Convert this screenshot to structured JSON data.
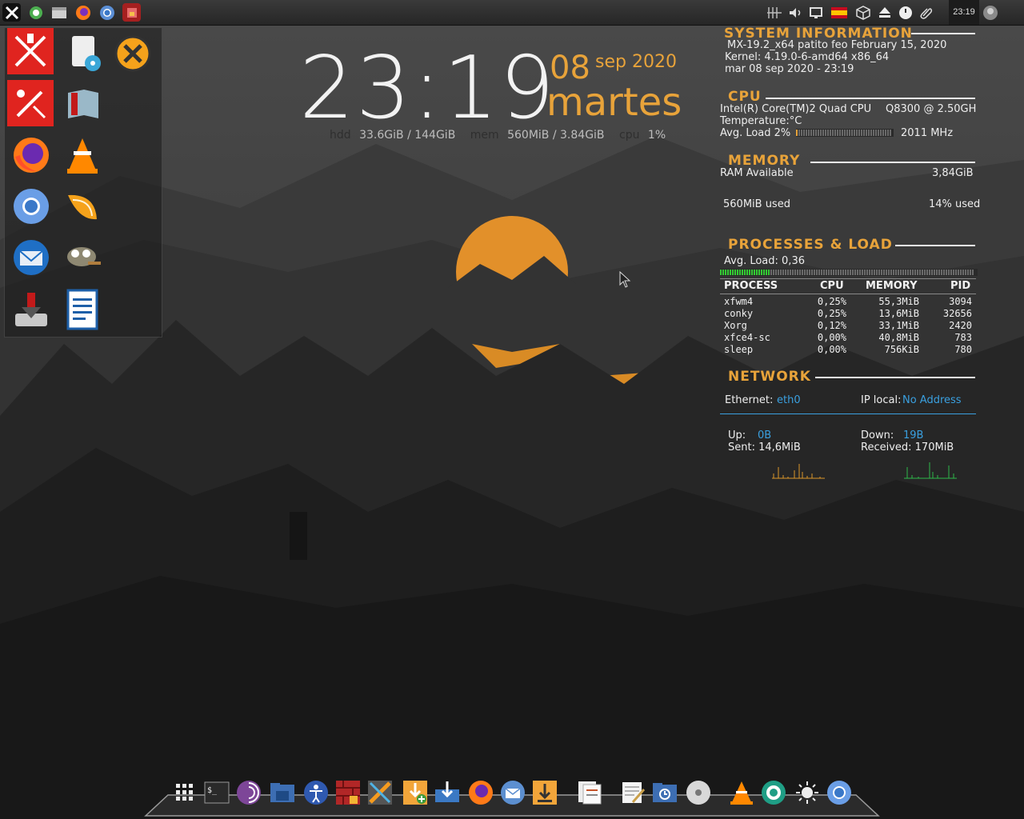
{
  "colors": {
    "accent": "#e8a33a",
    "text": "#eeeeee",
    "link": "#3aa0e0",
    "panel": "#2b2b2b"
  },
  "top_panel": {
    "launchers": [
      "mx-logo-icon",
      "update-icon",
      "file-manager-icon",
      "firefox-icon",
      "chromium-icon",
      "app-grid-icon"
    ],
    "tray": [
      "network-icon",
      "volume-icon",
      "display-icon",
      "spain-flag-icon",
      "package-icon",
      "eject-icon",
      "power-icon",
      "paperclip-icon"
    ],
    "clock": "23:19",
    "user": "avatar-icon"
  },
  "desktop_icons": [
    "mx-tools-icon",
    "document-viewer-icon",
    "crossover-icon",
    "mx-tweak-icon",
    "book-icon",
    "firefox-icon",
    "vlc-icon",
    "chromium-icon",
    "orange-icon",
    "thunderbird-icon",
    "gimp-icon",
    "installer-icon",
    "writer-icon"
  ],
  "clock_widget": {
    "time": "23:19",
    "day": "08",
    "month_year": "sep 2020",
    "weekday": "martes",
    "hdd_label": "hdd",
    "hdd_value": "33.6GiB / 144GiB",
    "mem_label": "mem",
    "mem_value": "560MiB / 3.84GiB",
    "cpu_label": "cpu",
    "cpu_value": "1%"
  },
  "conky": {
    "system": {
      "title": "SYSTEM INFORMATION",
      "line1": "MX-19.2_x64 patito feo February 15, 2020",
      "line2": "Kernel: 4.19.0-6-amd64 x86_64",
      "line3": "mar 08 sep 2020 - 23:19"
    },
    "cpu": {
      "title": "CPU",
      "model": "Intel(R) Core(TM)2 Quad CPU",
      "speed_model": "Q8300  @ 2.50GH",
      "temp": "Temperature:°C",
      "avg": "Avg. Load 2%",
      "avg_fraction": 0.02,
      "freq": "2011 MHz"
    },
    "memory": {
      "title": "MEMORY",
      "ram_label": "RAM Available",
      "ram_value": "3,84GiB",
      "used": "560MiB used",
      "used_pct": "14% used"
    },
    "processes": {
      "title": "PROCESSES & LOAD",
      "avg": "Avg. Load: 0,36",
      "avg_fraction": 0.2,
      "headers": [
        "PROCESS",
        "CPU",
        "MEMORY",
        "PID"
      ],
      "rows": [
        {
          "name": "xfwm4",
          "cpu": "0,25%",
          "mem": "55,3MiB",
          "pid": "3094"
        },
        {
          "name": "conky",
          "cpu": "0,25%",
          "mem": "13,6MiB",
          "pid": "32656"
        },
        {
          "name": "Xorg",
          "cpu": "0,12%",
          "mem": "33,1MiB",
          "pid": "2420"
        },
        {
          "name": "xfce4-sc",
          "cpu": "0,00%",
          "mem": "40,8MiB",
          "pid": "783"
        },
        {
          "name": "sleep",
          "cpu": "0,00%",
          "mem": "756KiB",
          "pid": "780"
        }
      ]
    },
    "network": {
      "title": "NETWORK",
      "eth_label": "Ethernet:",
      "eth_value": "eth0",
      "ip_label": "IP local:",
      "ip_value": "No Address",
      "up_label": "Up:",
      "up_value": "0B",
      "sent": "Sent: 14,6MiB",
      "down_label": "Down:",
      "down_value": "19B",
      "received": "Received: 170MiB"
    }
  },
  "dock": [
    "app-grid-icon",
    "terminal-icon",
    "tor-icon",
    "folder-icon",
    "accessibility-icon",
    "firewall-icon",
    "xfce-settings-icon",
    "download-plus-icon",
    "network-share-icon",
    "firefox-icon",
    "email-icon",
    "downloader-icon",
    "documents-icon",
    "text-editor-icon",
    "backup-folder-icon",
    "disc-icon",
    "vlc-icon",
    "shutter-icon",
    "brightness-icon",
    "chromium-icon"
  ]
}
